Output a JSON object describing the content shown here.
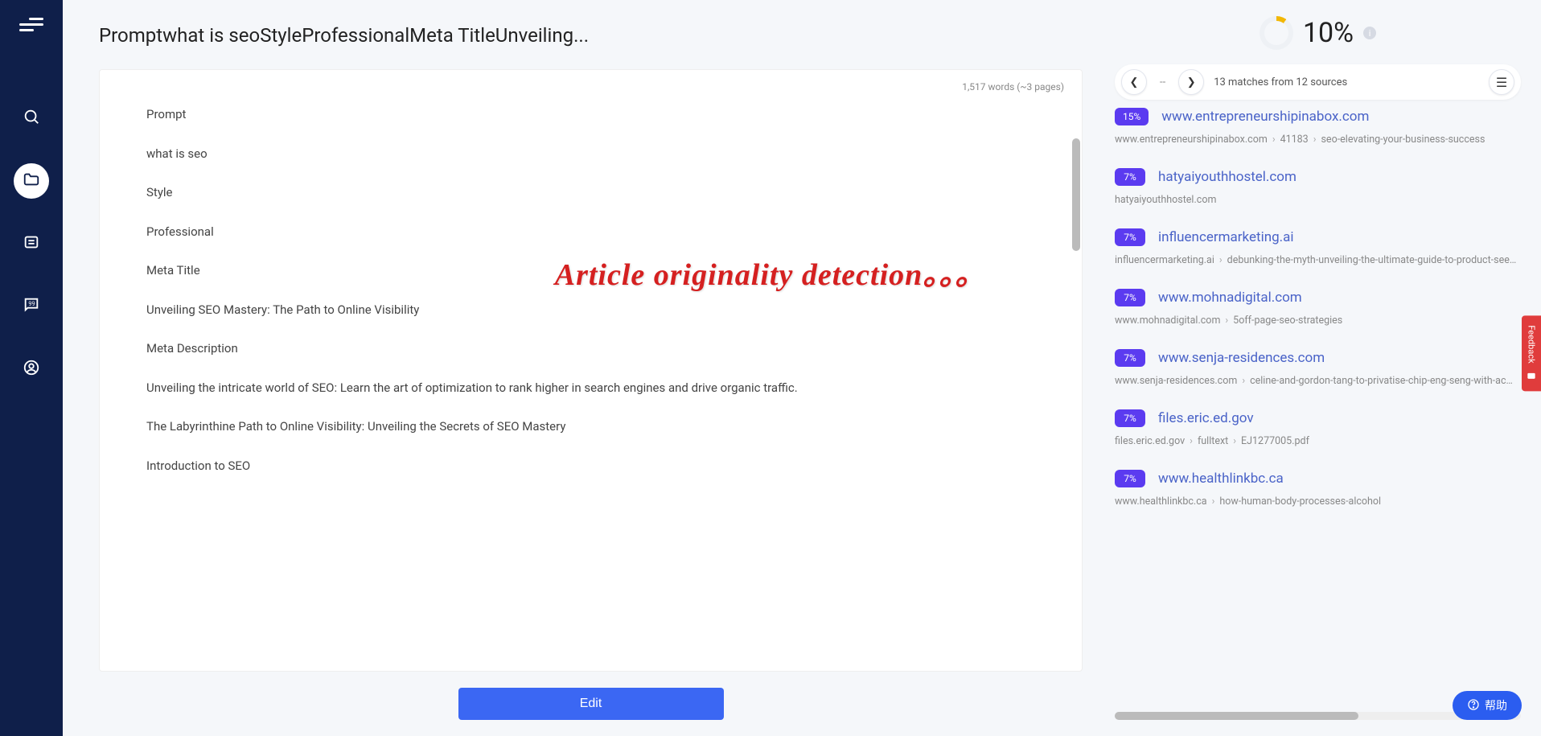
{
  "page_title": "Promptwhat is seoStyleProfessionalMeta TitleUnveiling...",
  "doc_meta": "1,517 words (~3 pages)",
  "watermark": "Article originality detection。。。",
  "paragraphs": [
    "Prompt",
    "what is seo",
    "Style",
    "Professional",
    "Meta Title",
    "Unveiling SEO Mastery: The Path to Online Visibility",
    "Meta Description",
    "Unveiling the intricate world of SEO: Learn the art of optimization to rank higher in search engines and drive organic traffic.",
    "The Labyrinthine Path to Online Visibility: Unveiling the Secrets of SEO Mastery",
    "Introduction to SEO"
  ],
  "edit_label": "Edit",
  "score": "10%",
  "match_nav": {
    "dashes": "--",
    "summary": "13 matches from 12 sources"
  },
  "sources": [
    {
      "pct": "15%",
      "link": "www.entrepreneurshipinabox.com",
      "path": [
        "www.entrepreneurshipinabox.com",
        "41183",
        "seo-elevating-your-business-success"
      ]
    },
    {
      "pct": "7%",
      "link": "hatyaiyouthhostel.com",
      "path": [
        "hatyaiyouthhostel.com"
      ]
    },
    {
      "pct": "7%",
      "link": "influencermarketing.ai",
      "path": [
        "influencermarketing.ai",
        "debunking-the-myth-unveiling-the-ultimate-guide-to-product-seeding-in-influe..."
      ]
    },
    {
      "pct": "7%",
      "link": "www.mohnadigital.com",
      "path": [
        "www.mohnadigital.com",
        "5off-page-seo-strategies"
      ]
    },
    {
      "pct": "7%",
      "link": "www.senja-residences.com",
      "path": [
        "www.senja-residences.com",
        "celine-and-gordon-tang-to-privatise-chip-eng-seng-with-acceptance-crossi..."
      ]
    },
    {
      "pct": "7%",
      "link": "files.eric.ed.gov",
      "path": [
        "files.eric.ed.gov",
        "fulltext",
        "EJ1277005.pdf"
      ]
    },
    {
      "pct": "7%",
      "link": "www.healthlinkbc.ca",
      "path": [
        "www.healthlinkbc.ca",
        "how-human-body-processes-alcohol"
      ]
    }
  ],
  "feedback_label": "Feedback",
  "help_label": "帮助"
}
